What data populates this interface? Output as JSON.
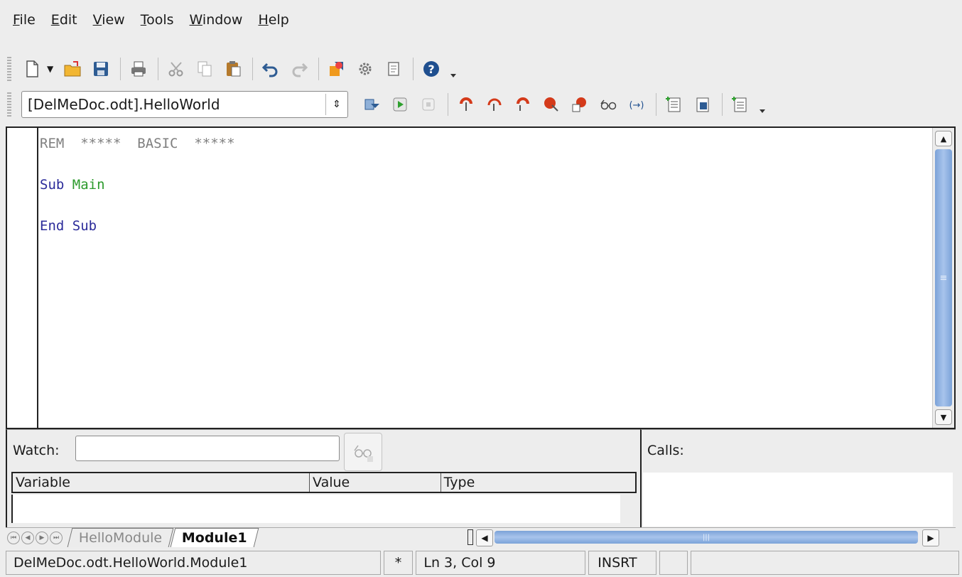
{
  "menu": {
    "items": [
      {
        "accel": "F",
        "rest": "ile"
      },
      {
        "accel": "E",
        "rest": "dit"
      },
      {
        "accel": "V",
        "rest": "iew"
      },
      {
        "accel": "T",
        "rest": "ools"
      },
      {
        "accel": "W",
        "rest": "indow"
      },
      {
        "accel": "H",
        "rest": "elp"
      }
    ]
  },
  "toolbar1": {
    "icons": [
      "new-document-icon",
      "open-folder-icon",
      "save-icon",
      "print-icon",
      "cut-icon",
      "copy-icon",
      "paste-icon",
      "undo-icon",
      "redo-icon",
      "object-catalog-icon",
      "macros-gear-icon",
      "dialog-scroll-icon",
      "help-icon"
    ]
  },
  "toolbar2": {
    "library_value": "[DelMeDoc.odt].HelloWorld",
    "icons": [
      "compile-icon",
      "run-icon",
      "stop-icon",
      "step-into-icon",
      "step-over-icon",
      "step-out-icon",
      "breakpoint-icon",
      "manage-breakpoints-icon",
      "enable-watch-icon",
      "find-parentheses-icon",
      "insert-basic-source-icon",
      "save-basic-icon",
      "import-dialog-icon"
    ]
  },
  "editor": {
    "lines": [
      {
        "parts": [
          {
            "cls": "c-rem",
            "text": "REM  *****  BASIC  *****"
          }
        ]
      },
      {
        "parts": []
      },
      {
        "parts": [
          {
            "cls": "c-kw",
            "text": "Sub "
          },
          {
            "cls": "c-id",
            "text": "Main"
          }
        ]
      },
      {
        "parts": []
      },
      {
        "parts": [
          {
            "cls": "c-kw",
            "text": "End Sub"
          }
        ]
      }
    ]
  },
  "watch": {
    "label": "Watch:",
    "value": "",
    "columns": [
      "Variable",
      "Value",
      "Type"
    ]
  },
  "calls": {
    "label": "Calls:"
  },
  "tabs": {
    "items": [
      "HelloModule",
      "Module1"
    ],
    "active_index": 1
  },
  "status": {
    "location": "DelMeDoc.odt.HelloWorld.Module1",
    "modified": "*",
    "position": "Ln 3, Col 9",
    "mode": "INSRT"
  }
}
